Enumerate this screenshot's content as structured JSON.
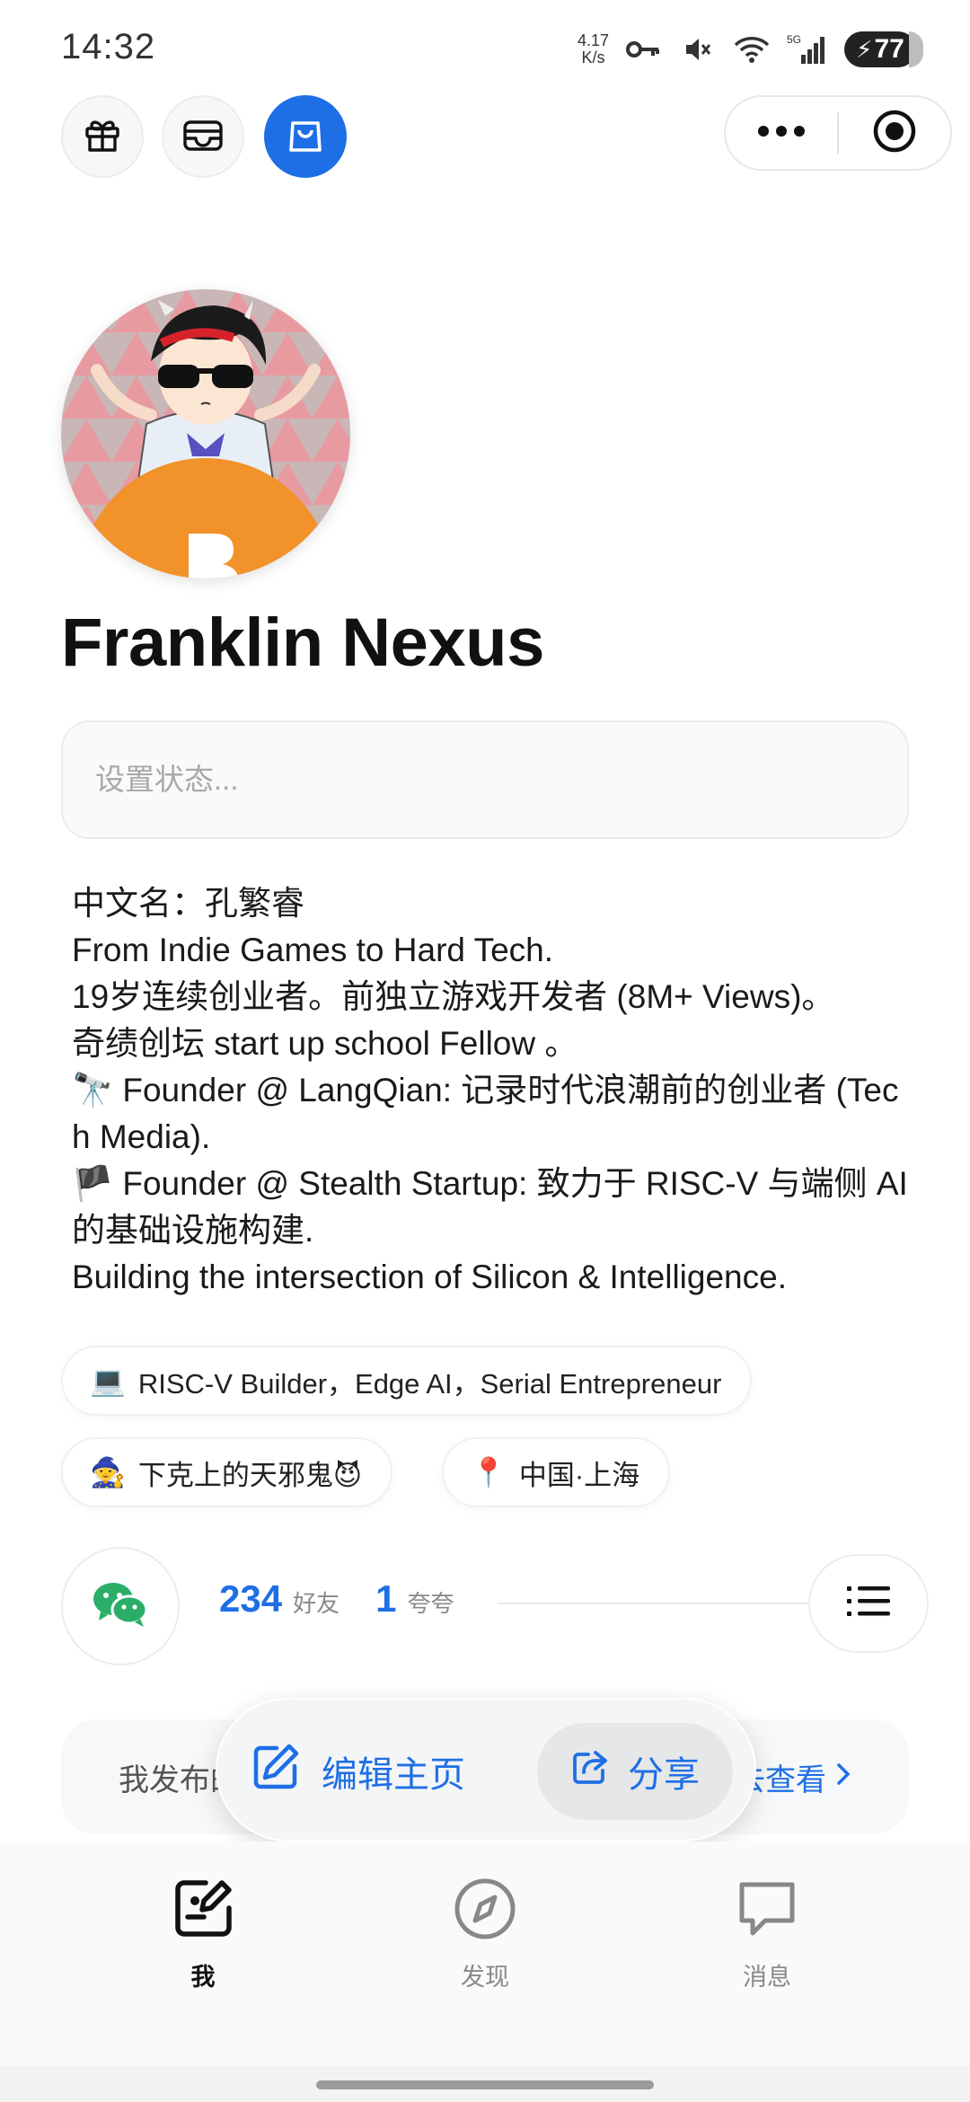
{
  "status_bar": {
    "time": "14:32",
    "net_speed_value": "4.17",
    "net_speed_unit": "K/s",
    "signal_type": "5G",
    "battery": "77"
  },
  "top_actions": {
    "gift_icon": "gift-icon",
    "wallet_icon": "wallet-icon",
    "bag_icon": "shopping-bag-icon",
    "more_icon": "more-dots-icon",
    "target_icon": "target-icon"
  },
  "profile": {
    "name": "Franklin Nexus",
    "status_placeholder": "设置状态...",
    "bio_lines": [
      "中文名：孔繁睿",
      "From Indie Games to Hard Tech.",
      "19岁连续创业者。前独立游戏开发者 (8M+ Views)。",
      "奇绩创坛 start up school Fellow 。",
      "🔭 Founder @ LangQian: 记录时代浪潮前的创业者 (Tech Media).",
      "🏴 Founder @ Stealth Startup: 致力于 RISC-V 与端侧 AI 的基础设施构建.",
      "Building the intersection of Silicon & Intelligence."
    ]
  },
  "tags": {
    "work": {
      "icon": "💻",
      "label": "RISC-V Builder，Edge AI，Serial Entrepreneur"
    },
    "persona": {
      "icon": "🧙",
      "label": "下克上的天邪鬼😈"
    },
    "location": {
      "icon": "📍",
      "label": "中国·上海"
    }
  },
  "social": {
    "friends_count": "234",
    "friends_label": "好友",
    "praise_count": "1",
    "praise_label": "夸夸"
  },
  "posts": {
    "label_visible": "我发布的",
    "link_visible": "去查看"
  },
  "actions": {
    "edit_label": "编辑主页",
    "share_label": "分享"
  },
  "bottom_nav": {
    "me": "我",
    "discover": "发现",
    "messages": "消息"
  },
  "colors": {
    "accent": "#1e6fe6",
    "wechat_green": "#2aae67"
  }
}
